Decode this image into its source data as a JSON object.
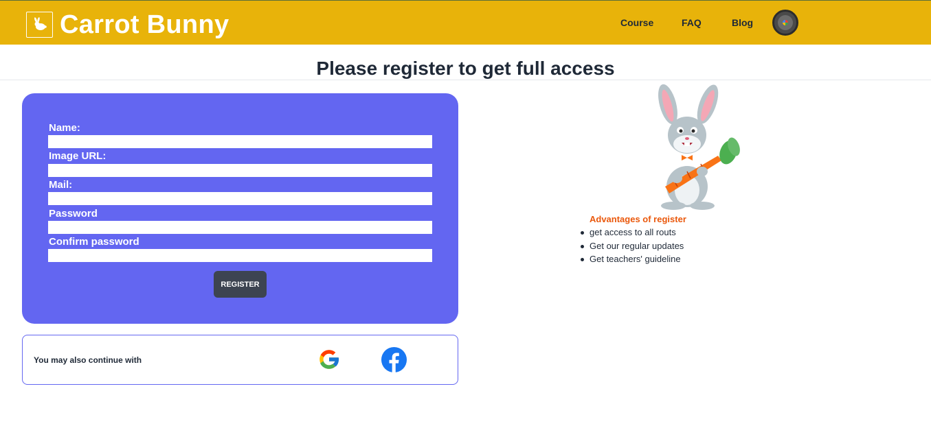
{
  "brand": {
    "name": "Carrot Bunny",
    "logo_icon": "rabbit-icon"
  },
  "nav": {
    "links": [
      "Course",
      "FAQ",
      "Blog"
    ],
    "avatar_icon": "user-avatar"
  },
  "page_title": "Please register to get full access",
  "form": {
    "fields": [
      {
        "label": "Name:",
        "value": ""
      },
      {
        "label": "Image URL:",
        "value": ""
      },
      {
        "label": "Mail:",
        "value": ""
      },
      {
        "label": "Password",
        "value": ""
      },
      {
        "label": "Confirm password",
        "value": ""
      }
    ],
    "submit_label": "REGISTER"
  },
  "social": {
    "text": "You may also continue with",
    "providers": [
      "google-icon",
      "facebook-icon"
    ]
  },
  "advantages": {
    "title": "Advantages of register",
    "items": [
      "get access to all routs",
      "Get our regular updates",
      "Get teachers' guideline"
    ]
  },
  "colors": {
    "navbar": "#e8b30a",
    "form_card": "#6366f1",
    "register_button": "#3d4451",
    "advantages_title": "#ea580c"
  }
}
